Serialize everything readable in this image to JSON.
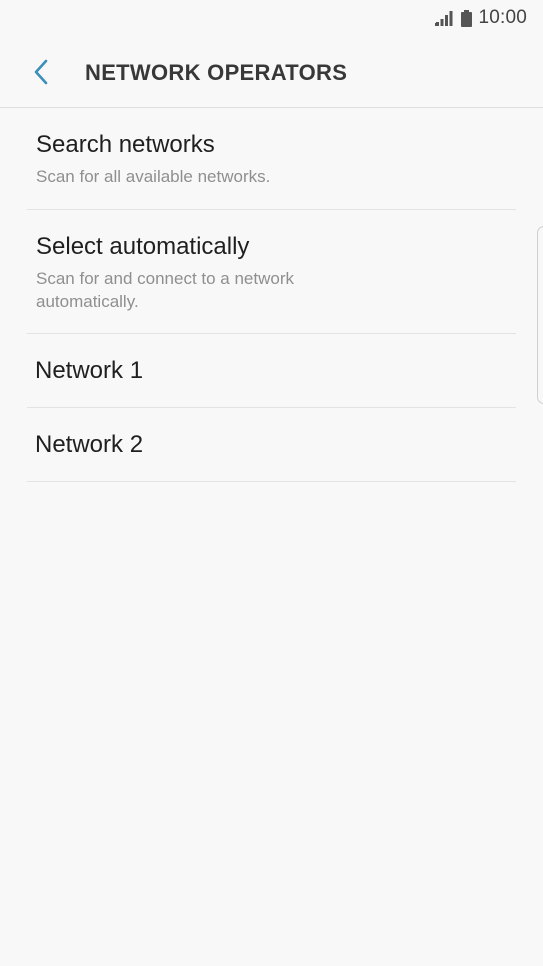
{
  "status_bar": {
    "time": "10:00",
    "icons": [
      "signal-icon",
      "battery-icon"
    ]
  },
  "header": {
    "back_icon": "chevron-left-icon",
    "title": "NETWORK OPERATORS"
  },
  "colors": {
    "accent": "#3d8eb9",
    "background": "#f8f8f8",
    "title_text": "#1f1f1f",
    "summary_text": "#8f8f8f"
  },
  "list": {
    "items": [
      {
        "title": "Search networks",
        "summary": "Scan for all available networks."
      },
      {
        "title": "Select automatically",
        "summary": "Scan for and connect to a network automatically."
      },
      {
        "title": "Network 1"
      },
      {
        "title": "Network 2"
      }
    ]
  }
}
